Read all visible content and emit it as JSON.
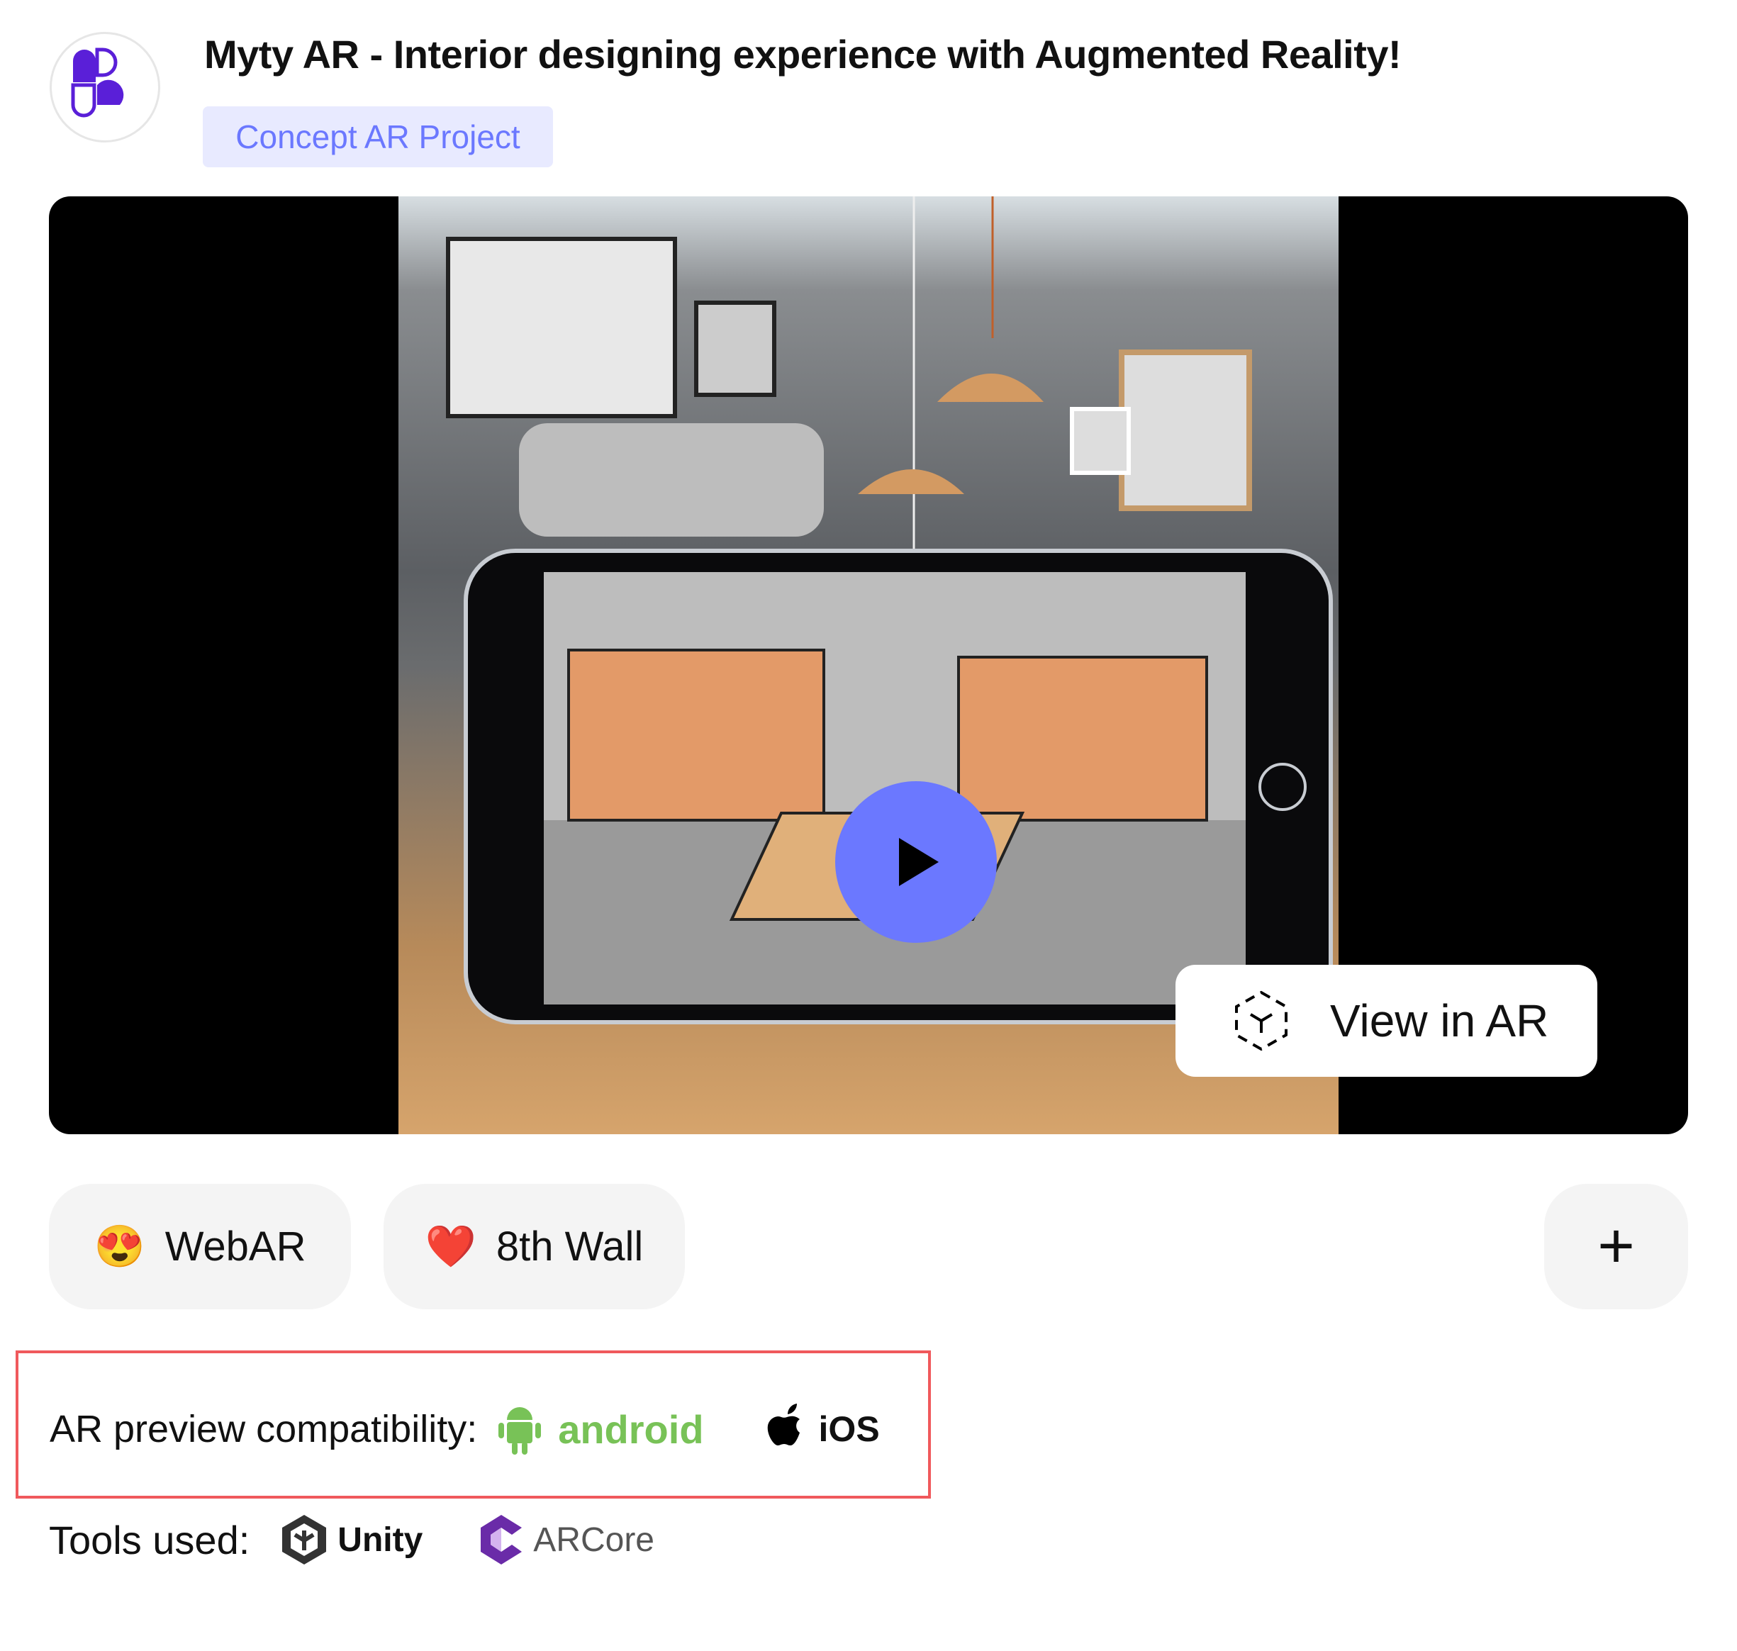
{
  "header": {
    "title": "Myty AR - Interior designing experience with Augmented Reality!",
    "badge": "Concept AR Project",
    "logo_color": "#5a1fd8"
  },
  "video": {
    "play_icon": "play-icon",
    "view_in_ar_label": "View in AR",
    "accent": "#6b78ff"
  },
  "tags": [
    {
      "emoji": "😍",
      "label": "WebAR"
    },
    {
      "emoji": "❤️",
      "label": "8th Wall"
    }
  ],
  "add_label": "+",
  "compatibility": {
    "label": "AR preview compatibility:",
    "platforms": [
      {
        "name": "android",
        "color": "#78c257"
      },
      {
        "name": "iOS",
        "color": "#000000"
      }
    ]
  },
  "tools": {
    "label": "Tools used:",
    "items": [
      {
        "name": "Unity"
      },
      {
        "name": "ARCore"
      }
    ]
  }
}
